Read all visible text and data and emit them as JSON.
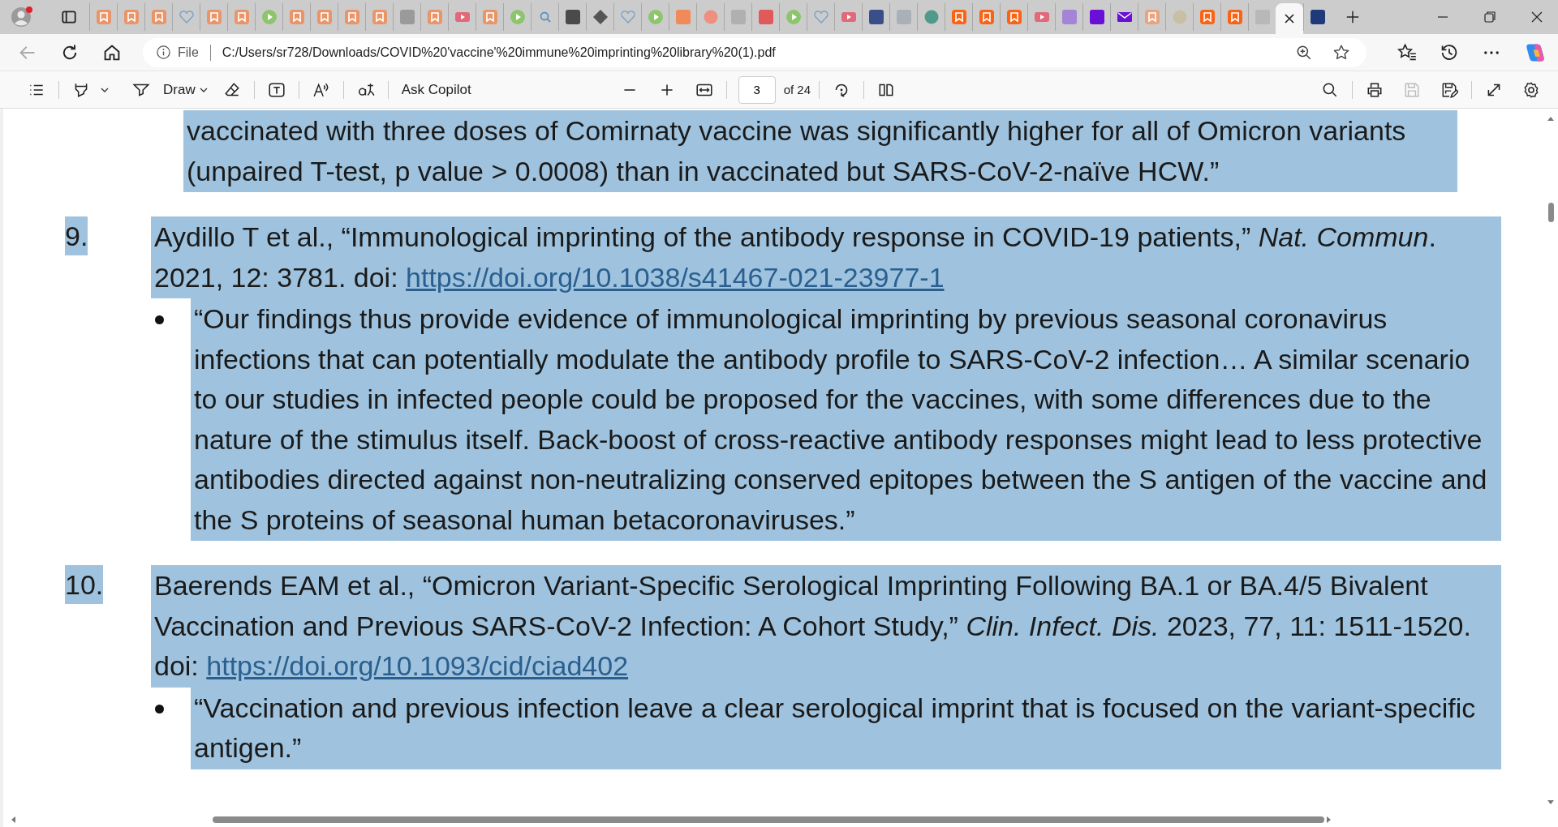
{
  "tabs": [
    {
      "kind": "bookmark",
      "color": "#e8956a",
      "selected": false
    },
    {
      "kind": "bookmark",
      "color": "#e8956a",
      "selected": false
    },
    {
      "kind": "bookmark",
      "color": "#e8956a",
      "selected": false
    },
    {
      "kind": "heart",
      "color": "#7fa6c9",
      "selected": false
    },
    {
      "kind": "bookmark",
      "color": "#e8956a",
      "selected": false
    },
    {
      "kind": "bookmark",
      "color": "#e8956a",
      "selected": false
    },
    {
      "kind": "play",
      "color": "#8cc56b",
      "selected": false
    },
    {
      "kind": "bookmark",
      "color": "#e8956a",
      "selected": false
    },
    {
      "kind": "bookmark",
      "color": "#e8956a",
      "selected": false
    },
    {
      "kind": "bookmark",
      "color": "#e8956a",
      "selected": false
    },
    {
      "kind": "bookmark",
      "color": "#e8956a",
      "selected": false
    },
    {
      "kind": "square",
      "color": "#9a9a9a",
      "selected": false
    },
    {
      "kind": "bookmark",
      "color": "#e8956a",
      "selected": false
    },
    {
      "kind": "video",
      "color": "#e06a7a",
      "selected": false
    },
    {
      "kind": "bookmark",
      "color": "#e8956a",
      "selected": false
    },
    {
      "kind": "play",
      "color": "#8cc56b",
      "selected": false
    },
    {
      "kind": "search",
      "color": "#5b8fc9",
      "selected": false
    },
    {
      "kind": "square",
      "color": "#4a4a4a",
      "selected": false
    },
    {
      "kind": "diamond",
      "color": "#555555",
      "selected": false
    },
    {
      "kind": "heart",
      "color": "#7fa6c9",
      "selected": false
    },
    {
      "kind": "play",
      "color": "#8cc56b",
      "selected": false
    },
    {
      "kind": "square",
      "color": "#ef8a5a",
      "selected": false
    },
    {
      "kind": "circle",
      "color": "#ef8f7f",
      "selected": false
    },
    {
      "kind": "square",
      "color": "#b0b0b0",
      "selected": false
    },
    {
      "kind": "square",
      "color": "#e05a5a",
      "selected": false
    },
    {
      "kind": "play",
      "color": "#8cc56b",
      "selected": false
    },
    {
      "kind": "heart",
      "color": "#7fa6c9",
      "selected": false
    },
    {
      "kind": "video",
      "color": "#e06a7a",
      "selected": false
    },
    {
      "kind": "square",
      "color": "#3a4f8a",
      "selected": false
    },
    {
      "kind": "square",
      "color": "#a9b0b8",
      "selected": false
    },
    {
      "kind": "circle",
      "color": "#4f9a8a",
      "selected": false
    },
    {
      "kind": "bookmark",
      "color": "#f96316",
      "selected": false
    },
    {
      "kind": "bookmark",
      "color": "#f96316",
      "selected": false
    },
    {
      "kind": "bookmark",
      "color": "#f96316",
      "selected": false
    },
    {
      "kind": "video",
      "color": "#e06a7a",
      "selected": false
    },
    {
      "kind": "square",
      "color": "#a384d6",
      "selected": false
    },
    {
      "kind": "square",
      "color": "#6a0fd6",
      "selected": false
    },
    {
      "kind": "mail",
      "color": "#6a0fd6",
      "selected": false
    },
    {
      "kind": "bookmark",
      "color": "#e8a37f",
      "selected": false
    },
    {
      "kind": "circle",
      "color": "#c9bfa5",
      "selected": false
    },
    {
      "kind": "bookmark",
      "color": "#f96316",
      "selected": false
    },
    {
      "kind": "bookmark",
      "color": "#f96316",
      "selected": false
    },
    {
      "kind": "square",
      "color": "#b8b8b8",
      "selected": false
    },
    {
      "kind": "blank",
      "color": "#f7f7f7",
      "selected": true
    },
    {
      "kind": "square",
      "color": "#1f3a7a",
      "selected": false
    }
  ],
  "address_bar": {
    "scheme": "File",
    "url": "C:/Users/sr728/Downloads/COVID%20'vaccine'%20immune%20imprinting%20library%20(1).pdf"
  },
  "pdf_toolbar": {
    "draw_label": "Draw",
    "copilot_label": "Ask Copilot",
    "page_number": "3",
    "page_count": "of 24"
  },
  "document": {
    "text_selected": true,
    "continued_quote": "vaccinated with three doses of Comirnaty vaccine was significantly higher for all of Omicron variants (unpaired T-test, p value > 0.0008) than in vaccinated but SARS-CoV-2-naïve HCW.”",
    "references": [
      {
        "number": "9.",
        "citation": "Aydillo T et al., “Immunological imprinting of the antibody response in COVID-19 patients,” *Nat. Commun*. 2021, 12: 3781. doi:",
        "link": "https://doi.org/10.1038/s41467-021-23977-1",
        "quotes": [
          "“Our findings thus provide evidence of immunological imprinting by previous seasonal coronavirus infections that can potentially modulate the antibody profile to SARS-CoV-2 infection… A similar scenario to our studies in infected people could be proposed for the vaccines, with some differences due to the nature of the stimulus itself. Back-boost of cross-reactive antibody responses might lead to less protective antibodies directed against non-neutralizing conserved epitopes between the S antigen of the vaccine and the S proteins of seasonal human betacoronaviruses.”"
        ]
      },
      {
        "number": "10.",
        "citation": "Baerends EAM et al., “Omicron Variant-Specific Serological Imprinting Following BA.1 or BA.4/5 Bivalent Vaccination and Previous SARS-CoV-2 Infection: A Cohort Study,” *Clin. Infect. Dis.* 2023, 77, 11: 1511-1520. doi:",
        "link": "https://doi.org/10.1093/cid/ciad402",
        "quotes": [
          "“Vaccination and previous infection leave a clear serological imprint that is focused on the variant-specific antigen.”"
        ]
      }
    ]
  }
}
